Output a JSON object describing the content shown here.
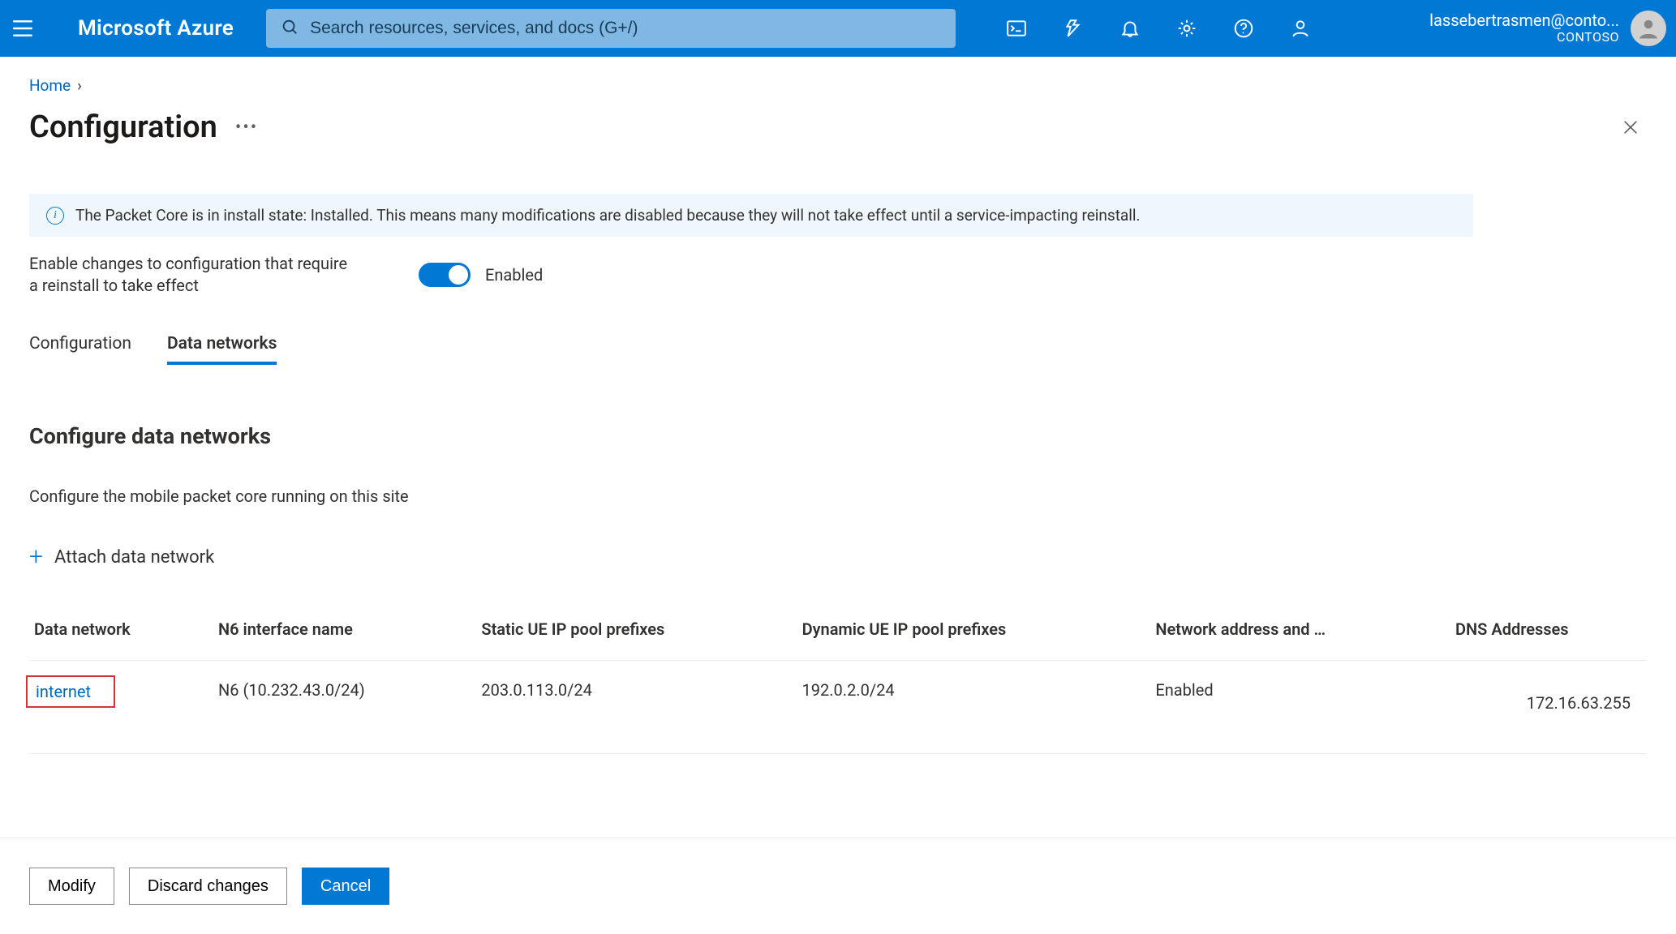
{
  "topbar": {
    "brand": "Microsoft Azure",
    "search_placeholder": "Search resources, services, and docs (G+/)",
    "account_email": "lassebertrasmen@conto...",
    "account_tenant": "CONTOSO"
  },
  "breadcrumb": {
    "home": "Home"
  },
  "page_title": "Configuration",
  "info_message": "The Packet Core is in install state: Installed. This means many modifications are disabled because they will not take effect until a service-impacting reinstall.",
  "toggle": {
    "label": "Enable changes to configuration that require a reinstall to take effect",
    "state_label": "Enabled"
  },
  "tabs": {
    "configuration": "Configuration",
    "data_networks": "Data networks"
  },
  "section": {
    "title": "Configure data networks",
    "desc": "Configure the mobile packet core running on this site",
    "attach": "Attach data network"
  },
  "table": {
    "headers": {
      "data_network": "Data network",
      "n6": "N6 interface name",
      "static_ue": "Static UE IP pool prefixes",
      "dynamic_ue": "Dynamic UE IP pool prefixes",
      "nat": "Network address and …",
      "dns": "DNS Addresses"
    },
    "rows": [
      {
        "data_network": "internet",
        "n6": "N6 (10.232.43.0/24)",
        "static_ue": "203.0.113.0/24",
        "dynamic_ue": "192.0.2.0/24",
        "nat": "Enabled",
        "dns": "172.16.63.255"
      }
    ]
  },
  "footer": {
    "modify": "Modify",
    "discard": "Discard changes",
    "cancel": "Cancel"
  }
}
